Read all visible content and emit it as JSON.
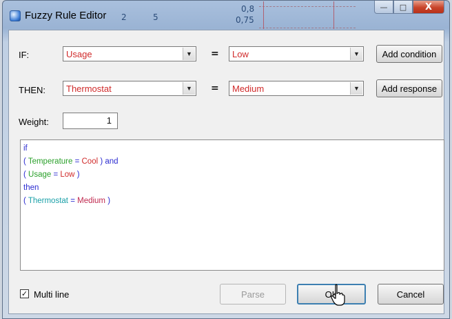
{
  "window": {
    "title": "Fuzzy Rule Editor",
    "background_glimpse": [
      "2",
      "5",
      "0,8",
      "0,75"
    ],
    "controls": {
      "minimize": "—",
      "maximize": "□",
      "close": "X"
    }
  },
  "if_row": {
    "label": "IF:",
    "variable": "Usage",
    "operator": "=",
    "term": "Low",
    "button": "Add condition"
  },
  "then_row": {
    "label": "THEN:",
    "variable": "Thermostat",
    "operator": "=",
    "term": "Medium",
    "button": "Add response"
  },
  "weight": {
    "label": "Weight:",
    "value": "1"
  },
  "rule_text": {
    "l1": "if",
    "l2_open": "( ",
    "l2_var": "Temperature",
    "l2_eq": " = ",
    "l2_val": "Cool",
    "l2_close": " )",
    "l2_and": " and",
    "l3_open": "( ",
    "l3_var": "Usage",
    "l3_eq": " = ",
    "l3_val": "Low",
    "l3_close": " )",
    "l4": "then",
    "l5_open": "( ",
    "l5_var": "Thermostat",
    "l5_eq": " = ",
    "l5_val": "Medium",
    "l5_close": " )"
  },
  "multiline": {
    "label": "Multi line",
    "checked": true,
    "mark": "✓"
  },
  "buttons": {
    "parse": "Parse",
    "ok": "OK",
    "cancel": "Cancel"
  },
  "colors": {
    "keyword": "#2a2ad0",
    "variable": "#2aa02a",
    "value": "#d02a2a",
    "output_var": "#1aa0a8",
    "output_value": "#c02a50"
  },
  "icons": {
    "app": "fuzzy-app-icon",
    "cursor": "mouse-pointer-icon",
    "dropdown": "chevron-down-icon"
  }
}
